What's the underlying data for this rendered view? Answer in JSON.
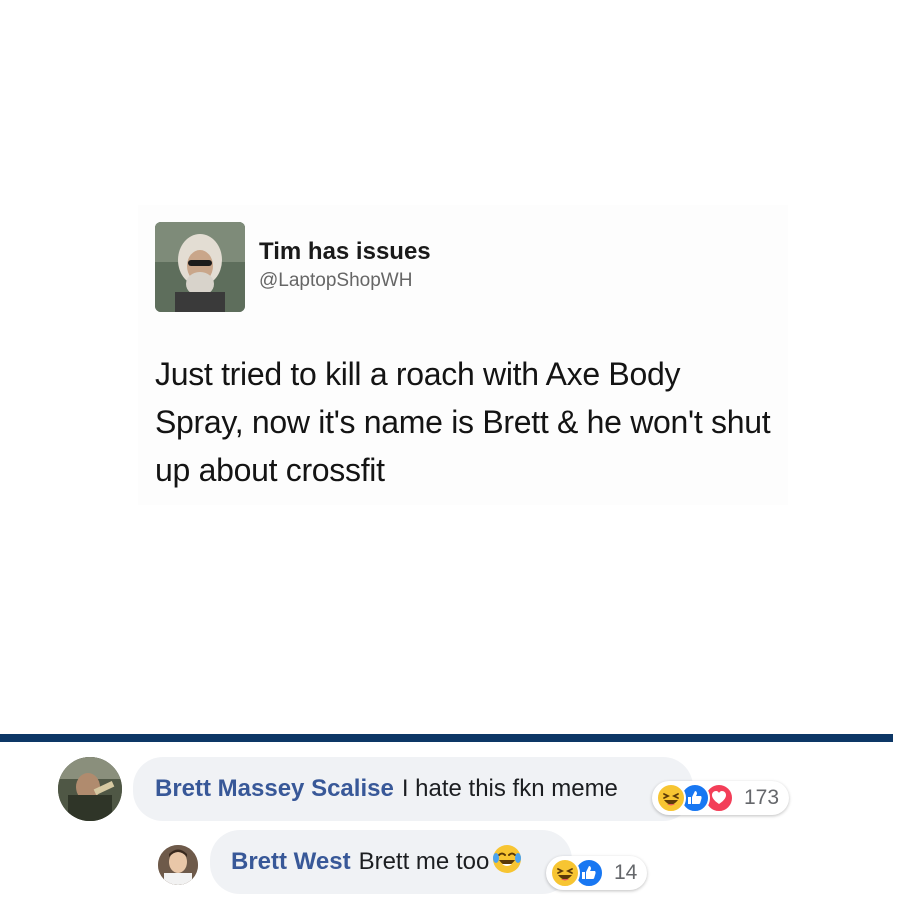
{
  "tweet": {
    "name": "Tim has issues",
    "handle": "@LaptopShopWH",
    "text": "Just tried to kill a roach with Axe Body Spray, now it's name is Brett & he won't shut up about crossfit"
  },
  "comments": [
    {
      "author": "Brett Massey Scalise",
      "text": "I hate this fkn meme",
      "reactions": [
        "haha-icon",
        "like-icon",
        "love-icon"
      ],
      "reaction_count": "173"
    },
    {
      "author": "Brett West",
      "text": "Brett me too",
      "inline_emoji": "laughing-tears-emoji",
      "reactions": [
        "haha-icon",
        "like-icon"
      ],
      "reaction_count": "14"
    }
  ],
  "colors": {
    "divider": "#0d3766",
    "author": "#385898",
    "bubble": "#f0f2f5",
    "like": "#1877f2",
    "love": "#f33e58",
    "haha": "#f7c532"
  }
}
